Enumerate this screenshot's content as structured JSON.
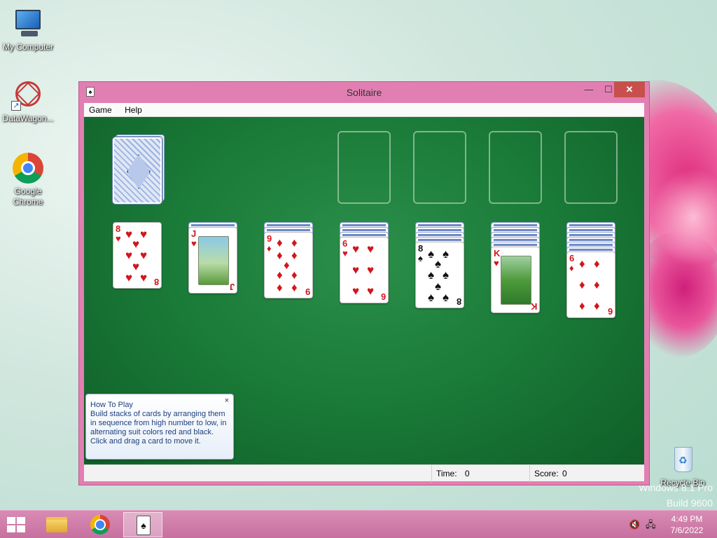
{
  "desktop": {
    "icons": [
      {
        "label": "My Computer"
      },
      {
        "label": "DataWagon..."
      },
      {
        "label": "Google Chrome"
      },
      {
        "label": "Recycle Bin"
      }
    ],
    "watermark_line1": "Windows 8.1 Pro",
    "watermark_line2": "Build 9600"
  },
  "window": {
    "title": "Solitaire",
    "controls": {
      "minimize": "—",
      "maximize": "☐",
      "close": "✕"
    },
    "menu": [
      "Game",
      "Help"
    ],
    "status": {
      "time_label": "Time:",
      "time_value": "0",
      "score_label": "Score:",
      "score_value": "0"
    }
  },
  "game": {
    "stock": {
      "state": "face-down deck"
    },
    "foundations": [
      "empty",
      "empty",
      "empty",
      "empty"
    ],
    "tableau": [
      {
        "hidden": 0,
        "top": {
          "rank": "8",
          "suit": "♥",
          "color": "red"
        }
      },
      {
        "hidden": 1,
        "top": {
          "rank": "J",
          "suit": "♥",
          "color": "red"
        }
      },
      {
        "hidden": 2,
        "top": {
          "rank": "9",
          "suit": "♦",
          "color": "red"
        }
      },
      {
        "hidden": 3,
        "top": {
          "rank": "6",
          "suit": "♥",
          "color": "red"
        }
      },
      {
        "hidden": 4,
        "top": {
          "rank": "8",
          "suit": "♠",
          "color": "black"
        }
      },
      {
        "hidden": 5,
        "top": {
          "rank": "K",
          "suit": "♥",
          "color": "red"
        }
      },
      {
        "hidden": 6,
        "top": {
          "rank": "6",
          "suit": "♦",
          "color": "red"
        }
      }
    ]
  },
  "tooltip": {
    "title": "How To Play",
    "body": "Build stacks of cards by arranging them in sequence from high number to low, in alternating suit colors red and black. Click and drag a card to move it.",
    "close": "×"
  },
  "taskbar": {
    "clock_time": "4:49 PM",
    "clock_date": "7/6/2022",
    "solitaire_glyph": "♠"
  },
  "colors": {
    "felt": "#1a7a38",
    "window_frame": "#e27fb2",
    "close_button": "#c7504c",
    "taskbar": "#c7709f"
  }
}
